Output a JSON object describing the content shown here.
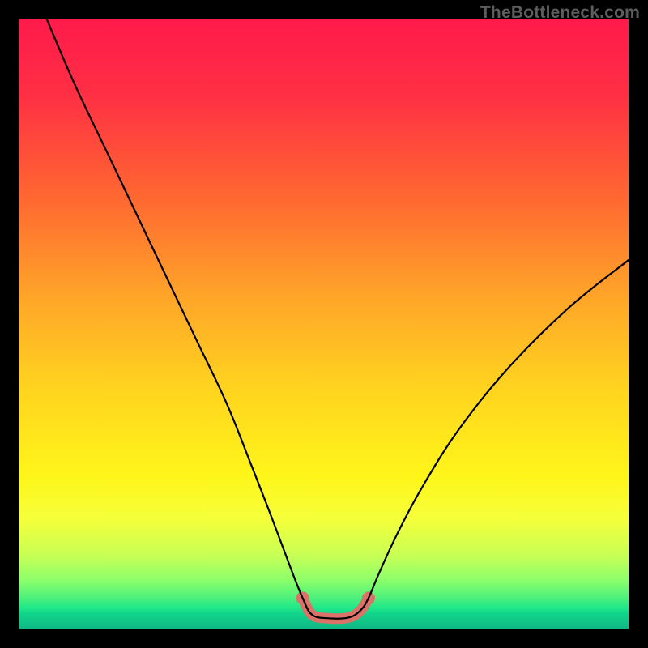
{
  "watermark": "TheBottleneck.com",
  "chart_data": {
    "type": "line",
    "title": "",
    "xlabel": "",
    "ylabel": "",
    "xlim": [
      0,
      100
    ],
    "ylim": [
      0,
      100
    ],
    "legend": false,
    "grid": false,
    "gradient_stops": [
      {
        "pos": 0.0,
        "color": "#ff1a4b"
      },
      {
        "pos": 0.12,
        "color": "#ff2e44"
      },
      {
        "pos": 0.3,
        "color": "#ff6a30"
      },
      {
        "pos": 0.45,
        "color": "#ffa329"
      },
      {
        "pos": 0.6,
        "color": "#ffd21f"
      },
      {
        "pos": 0.75,
        "color": "#fff61a"
      },
      {
        "pos": 0.82,
        "color": "#f5ff3a"
      },
      {
        "pos": 0.88,
        "color": "#c8ff55"
      },
      {
        "pos": 0.92,
        "color": "#8dff6a"
      },
      {
        "pos": 0.95,
        "color": "#4cf07c"
      },
      {
        "pos": 0.965,
        "color": "#22e989"
      },
      {
        "pos": 0.975,
        "color": "#11d58b"
      },
      {
        "pos": 1.0,
        "color": "#0fb885"
      }
    ],
    "series": [
      {
        "name": "bottleneck-curve",
        "stroke": "#000000",
        "x": [
          4.5,
          9,
          14,
          19,
          24,
          29,
          34,
          38,
          41.5,
          44.5,
          46.5,
          48,
          50.5,
          54,
          56,
          57.3,
          59,
          62,
          66,
          72,
          80,
          90,
          100
        ],
        "y": [
          100,
          89.5,
          79,
          68.5,
          58,
          47.5,
          37,
          27,
          18,
          10,
          5,
          2.3,
          1.7,
          1.8,
          3,
          5,
          9,
          15.5,
          23,
          32.5,
          42.5,
          52.5,
          60.5
        ]
      },
      {
        "name": "flat-band-highlight",
        "stroke": "#dc7168",
        "stroke_width": 13,
        "x": [
          46.5,
          48,
          50.5,
          54,
          56,
          57.3
        ],
        "y": [
          5,
          2.3,
          1.7,
          1.8,
          3,
          5
        ],
        "endpoints": true
      }
    ]
  }
}
